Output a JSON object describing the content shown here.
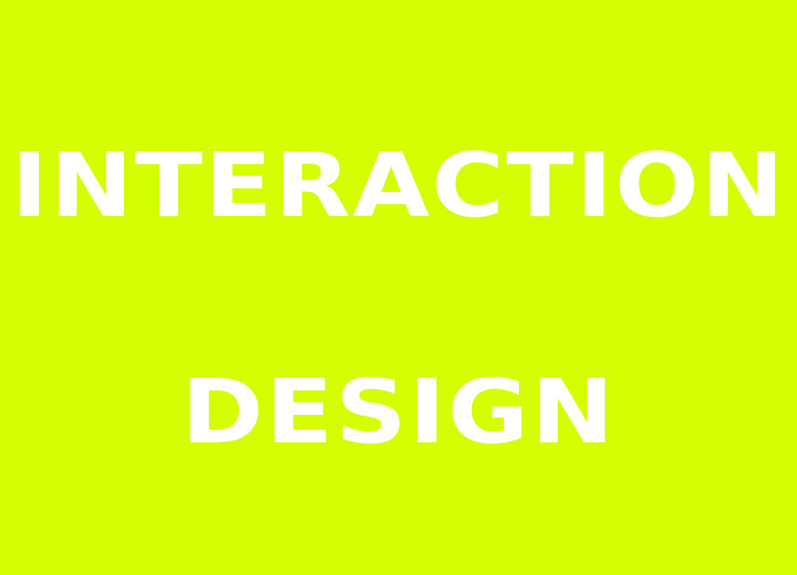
{
  "poster": {
    "background_color": "#d4ff00",
    "text_color": "#ffffff",
    "line_1": "INTERACTION",
    "line_2": "DESIGN"
  }
}
